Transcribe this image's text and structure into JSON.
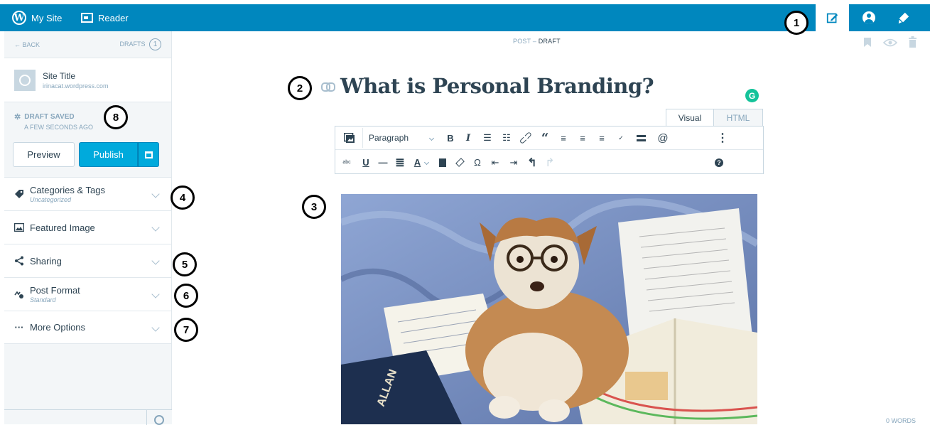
{
  "topbar": {
    "my_site": "My Site",
    "reader": "Reader"
  },
  "sidebar": {
    "back": "BACK",
    "drafts_label": "DRAFTS",
    "drafts_count": "1",
    "site_title": "Site Title",
    "site_url": "irinacat.wordpress.com",
    "status_title": "DRAFT SAVED",
    "status_time": "A FEW SECONDS AGO",
    "preview": "Preview",
    "publish": "Publish",
    "sections": [
      {
        "label": "Categories & Tags",
        "sub": "Uncategorized",
        "icon": "tag-icon"
      },
      {
        "label": "Featured Image",
        "sub": "",
        "icon": "image-icon"
      },
      {
        "label": "Sharing",
        "sub": "",
        "icon": "share-icon"
      },
      {
        "label": "Post Format",
        "sub": "Standard",
        "icon": "post-format-icon"
      },
      {
        "label": "More Options",
        "sub": "",
        "icon": "ellipsis-icon"
      }
    ]
  },
  "editor": {
    "status_prefix": "POST",
    "status_sep": "–",
    "status": "DRAFT",
    "title": "What is Personal Branding?",
    "grammarly": "G",
    "tab_visual": "Visual",
    "tab_html": "HTML",
    "paragraph": "Paragraph",
    "word_count": "0 WORDS"
  },
  "callouts": [
    "1",
    "2",
    "3",
    "4",
    "5",
    "6",
    "7",
    "8"
  ],
  "colors": {
    "masterbar": "#0087be",
    "publish": "#00aadc",
    "grammarly": "#15c39a"
  }
}
